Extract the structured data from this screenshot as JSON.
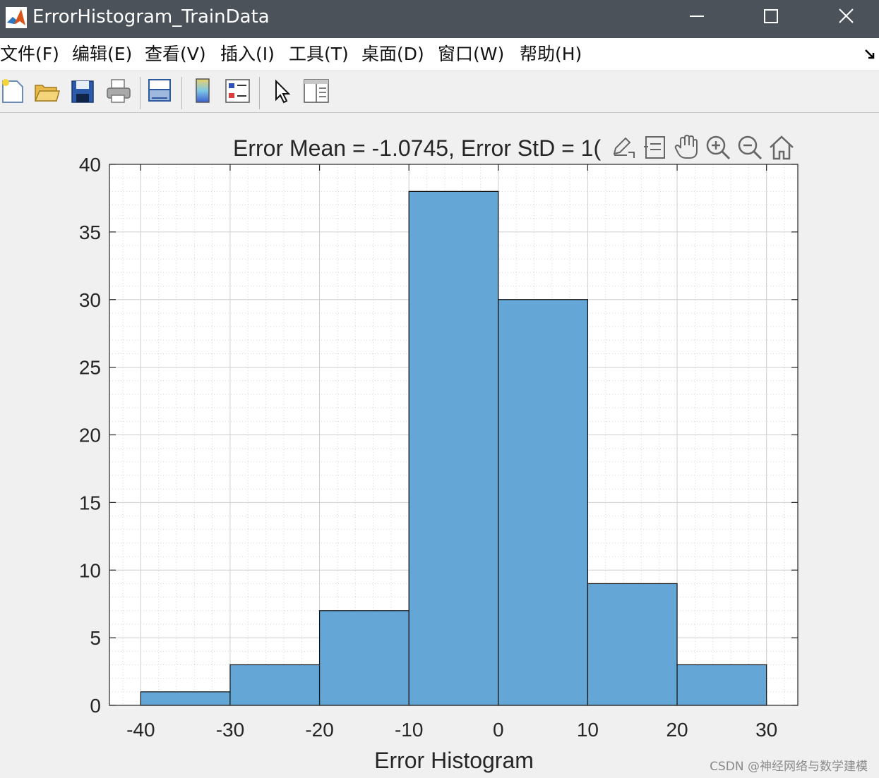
{
  "window": {
    "title": "ErrorHistogram_TrainData",
    "app_icon": "matlab-icon",
    "controls": [
      "minimize-icon",
      "maximize-icon",
      "close-icon"
    ]
  },
  "menu": {
    "items": [
      "文件(F)",
      "编辑(E)",
      "查看(V)",
      "插入(I)",
      "工具(T)",
      "桌面(D)",
      "窗口(W)",
      "帮助(H)"
    ]
  },
  "toolbar": {
    "icons": [
      "new-figure-icon",
      "open-file-icon",
      "save-icon",
      "print-icon",
      "link-plot-icon",
      "colorbar-icon",
      "legend-icon",
      "edit-plot-icon",
      "property-inspector-icon"
    ]
  },
  "axes_toolbar": {
    "icons": [
      "export-icon",
      "data-tips-icon",
      "pan-icon",
      "zoom-in-icon",
      "zoom-out-icon",
      "home-icon"
    ]
  },
  "chart_data": {
    "type": "bar",
    "title": "Error Mean = -1.0745, Error StD = 1(",
    "xlabel": "Error Histogram",
    "ylabel": "",
    "bin_edges": [
      -40,
      -30,
      -20,
      -10,
      0,
      10,
      20,
      30
    ],
    "values": [
      1,
      3,
      7,
      38,
      30,
      9,
      3
    ],
    "xlim": [
      -43.5,
      33.5
    ],
    "ylim": [
      0,
      40
    ],
    "xticks": [
      -40,
      -30,
      -20,
      -10,
      0,
      10,
      20,
      30
    ],
    "yticks": [
      0,
      5,
      10,
      15,
      20,
      25,
      30,
      35,
      40
    ],
    "grid": true,
    "minor_grid": true,
    "bar_color": "#64a6d5"
  },
  "watermark": "CSDN @神经网络与数学建模"
}
